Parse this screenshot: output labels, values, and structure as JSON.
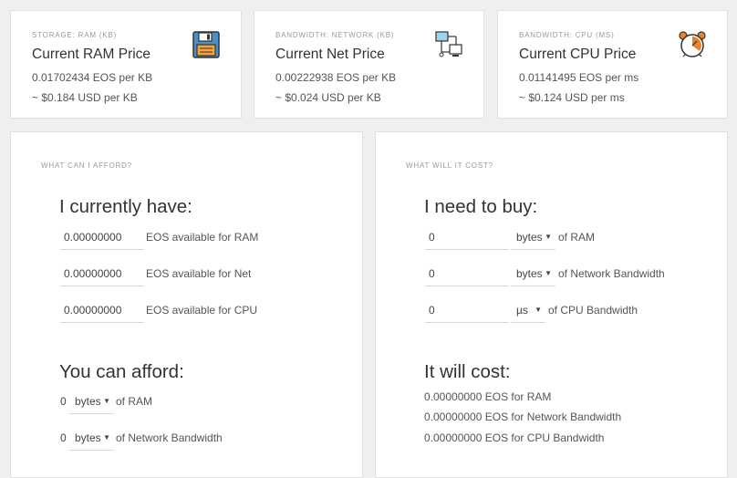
{
  "prices": [
    {
      "category": "STORAGE: RAM (KB)",
      "title": "Current RAM Price",
      "eos": "0.01702434 EOS per KB",
      "usd": "~ $0.184 USD per KB",
      "icon": "floppy-disk-icon"
    },
    {
      "category": "BANDWIDTH: NETWORK (KB)",
      "title": "Current Net Price",
      "eos": "0.00222938 EOS per KB",
      "usd": "~ $0.024 USD per KB",
      "icon": "network-icon"
    },
    {
      "category": "BANDWIDTH: CPU (MS)",
      "title": "Current CPU Price",
      "eos": "0.01141495 EOS per ms",
      "usd": "~ $0.124 USD per ms",
      "icon": "alarm-clock-icon"
    }
  ],
  "afford": {
    "section_label": "WHAT CAN I AFFORD?",
    "heading": "I currently have:",
    "inputs": [
      {
        "value": "0.00000000",
        "label": "EOS available for RAM"
      },
      {
        "value": "0.00000000",
        "label": "EOS available for Net"
      },
      {
        "value": "0.00000000",
        "label": "EOS available for CPU"
      }
    ],
    "result_heading": "You can afford:",
    "results": [
      {
        "amount": "0",
        "unit": "bytes",
        "label": "of RAM"
      },
      {
        "amount": "0",
        "unit": "bytes",
        "label": "of Network Bandwidth"
      }
    ]
  },
  "cost": {
    "section_label": "WHAT WILL IT COST?",
    "heading": "I need to buy:",
    "inputs": [
      {
        "value": "0",
        "unit": "bytes",
        "label": "of RAM"
      },
      {
        "value": "0",
        "unit": "bytes",
        "label": "of Network Bandwidth"
      },
      {
        "value": "0",
        "unit": "µs",
        "label": "of CPU Bandwidth"
      }
    ],
    "result_heading": "It will cost:",
    "results": [
      "0.00000000 EOS for RAM",
      "0.00000000 EOS for Network Bandwidth",
      "0.00000000 EOS for CPU Bandwidth"
    ]
  },
  "colors": {
    "accent": "#f5a33a",
    "icon_blue": "#4a90c8",
    "icon_orange": "#e8822c"
  }
}
